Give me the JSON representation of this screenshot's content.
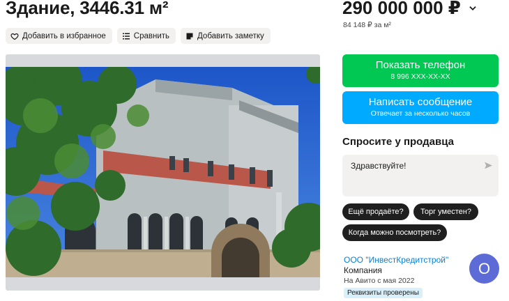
{
  "listing": {
    "title": "Здание, 3446.31 м²"
  },
  "actions": {
    "favorite_label": "Добавить в избранное",
    "compare_label": "Сравнить",
    "note_label": "Добавить заметку"
  },
  "gallery": {
    "image_description": "Историческое здание с арочными окнами и деревьями"
  },
  "pricing": {
    "price": "290 000 000 ₽",
    "price_per_sqm": "84 148 ₽ за м²"
  },
  "contact": {
    "phone_button_label": "Показать телефон",
    "phone_masked": "8 996 XXX-XX-XX",
    "message_button_label": "Написать сообщение",
    "message_button_sub": "Отвечает за несколько часов"
  },
  "ask": {
    "title": "Спросите у продавца",
    "message_value": "Здравствуйте!",
    "quick_questions": [
      "Ещё продаёте?",
      "Торг уместен?",
      "Когда можно посмотреть?"
    ]
  },
  "seller": {
    "name": "ООО \"ИнвестКредитстрой\"",
    "type": "Компания",
    "since": "На Авито с мая 2022",
    "verified_badge": "Реквизиты проверены",
    "avatar_letter": "О"
  },
  "colors": {
    "phone_button": "#00c853",
    "message_button": "#00aaff",
    "seller_link": "#0a7fd1",
    "avatar": "#5c6bd6",
    "chip": "#1f1f1f"
  },
  "icons": {
    "favorite": "heart-icon",
    "compare": "compare-icon",
    "note": "note-icon",
    "price_dropdown": "chevron-down-icon",
    "send": "send-icon"
  }
}
